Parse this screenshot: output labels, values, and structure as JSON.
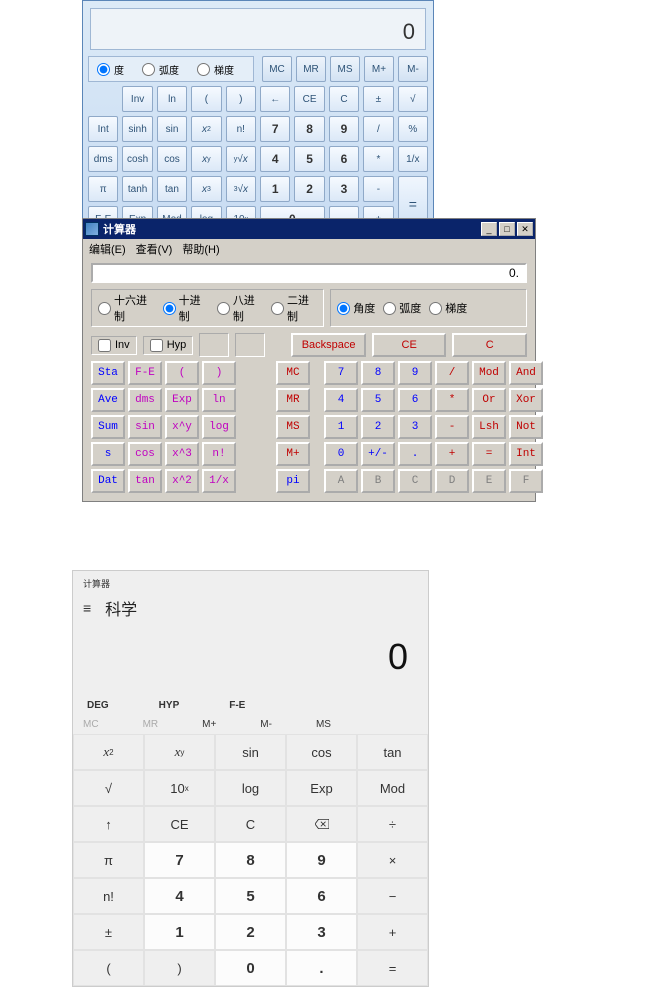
{
  "calc1": {
    "display": "0",
    "angles": [
      "度",
      "弧度",
      "梯度"
    ],
    "mem": [
      "MC",
      "MR",
      "MS",
      "M+",
      "M-"
    ],
    "rows": [
      [
        "",
        "Inv",
        "ln",
        "(",
        ")",
        "←",
        "CE",
        "C",
        "±",
        "√"
      ],
      [
        "Int",
        "sinh",
        "sin",
        "x²",
        "n!",
        "7",
        "8",
        "9",
        "/",
        "%"
      ],
      [
        "dms",
        "cosh",
        "cos",
        "xʸ",
        "ʸ√x",
        "4",
        "5",
        "6",
        "*",
        "1/x"
      ],
      [
        "π",
        "tanh",
        "tan",
        "x³",
        "³√x",
        "1",
        "2",
        "3",
        "-",
        "="
      ],
      [
        "F-E",
        "Exp",
        "Mod",
        "log",
        "10ˣ",
        "0",
        "0",
        ".",
        "+",
        "="
      ]
    ]
  },
  "calc2": {
    "title": "计算器",
    "menu": [
      "编辑(E)",
      "查看(V)",
      "帮助(H)"
    ],
    "display": "0.",
    "bases": [
      "十六进制",
      "十进制",
      "八进制",
      "二进制"
    ],
    "angles": [
      "角度",
      "弧度",
      "梯度"
    ],
    "invhyp": [
      "Inv",
      "Hyp"
    ],
    "bigbtns": [
      "Backspace",
      "CE",
      "C"
    ],
    "left": [
      [
        "Sta",
        "F-E",
        "(",
        ")",
        "",
        "MC"
      ],
      [
        "Ave",
        "dms",
        "Exp",
        "ln",
        "",
        "MR"
      ],
      [
        "Sum",
        "sin",
        "x^y",
        "log",
        "",
        "MS"
      ],
      [
        "s",
        "cos",
        "x^3",
        "n!",
        "",
        "M+"
      ],
      [
        "Dat",
        "tan",
        "x^2",
        "1/x",
        "",
        "pi"
      ]
    ],
    "right": [
      [
        "7",
        "8",
        "9",
        "/",
        "Mod",
        "And"
      ],
      [
        "4",
        "5",
        "6",
        "*",
        "Or",
        "Xor"
      ],
      [
        "1",
        "2",
        "3",
        "-",
        "Lsh",
        "Not"
      ],
      [
        "0",
        "+/-",
        ".",
        "+",
        "=",
        "Int"
      ],
      [
        "A",
        "B",
        "C",
        "D",
        "E",
        "F"
      ]
    ]
  },
  "calc3": {
    "appname": "计算器",
    "mode": "科学",
    "display": "0",
    "topfn": [
      "DEG",
      "HYP",
      "F-E"
    ],
    "memrow": [
      "MC",
      "MR",
      "M+",
      "M-",
      "MS"
    ],
    "grid": [
      [
        "x²",
        "xʸ",
        "sin",
        "cos",
        "tan"
      ],
      [
        "√",
        "10ˣ",
        "log",
        "Exp",
        "Mod"
      ],
      [
        "↑",
        "CE",
        "C",
        "⌫",
        "÷"
      ],
      [
        "π",
        "7",
        "8",
        "9",
        "×"
      ],
      [
        "n!",
        "4",
        "5",
        "6",
        "−"
      ],
      [
        "±",
        "1",
        "2",
        "3",
        "+"
      ],
      [
        "(",
        ")",
        "0",
        ".",
        "="
      ]
    ]
  }
}
